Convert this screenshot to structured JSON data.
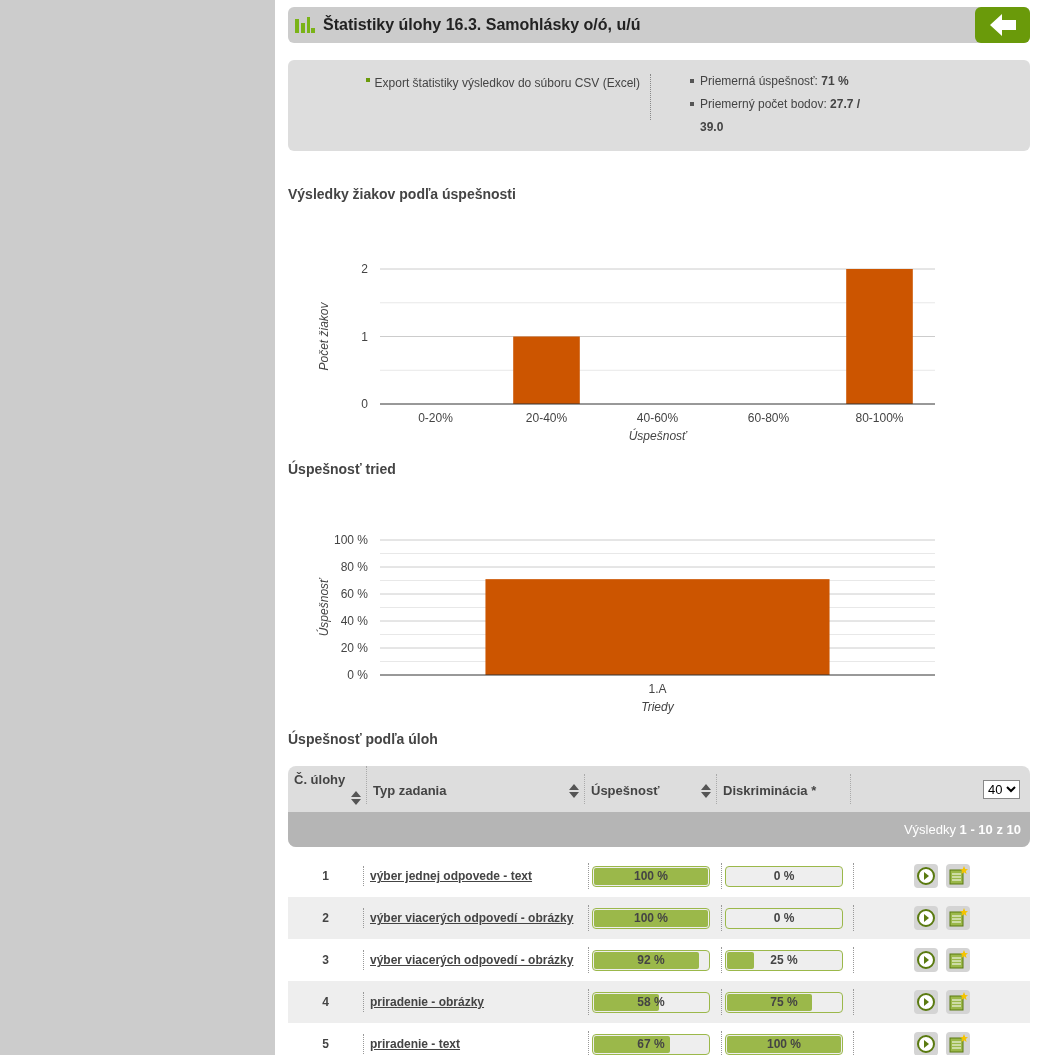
{
  "header": {
    "title": "Štatistiky úlohy 16.3. Samohlásky o/ó, u/ú"
  },
  "summary": {
    "export_link": "Export štatistiky výsledkov do súboru CSV (Excel)",
    "stats": [
      "Priemerná úspešnosť: **71 %**",
      "Priemerný počet bodov: **27.7 / 39.0**"
    ]
  },
  "sections": [
    {
      "title": "Výsledky žiakov podľa úspešnosti",
      "chart_data": {
        "type": "bar",
        "xlabel": "Úspešnosť",
        "ylabel": "Počet žiakov",
        "categories": [
          "0-20%",
          "20-40%",
          "40-60%",
          "60-80%",
          "80-100%"
        ],
        "series": [
          {
            "color": "#cc5500",
            "values": [
              0,
              1,
              0,
              0,
              2
            ]
          }
        ],
        "grid": true,
        "ref_lines": [
          {
            "axis": "y",
            "value": 0.5
          },
          {
            "axis": "y",
            "value": 1.5
          }
        ],
        "ylim": [
          0,
          2
        ],
        "yticks": [
          0,
          1,
          2
        ]
      }
    },
    {
      "title": "Úspešnosť tried",
      "chart_data": {
        "type": "bar",
        "xlabel": "Triedy",
        "ylabel": "Úspešnosť",
        "categories": [
          "1.A"
        ],
        "series": [
          {
            "color": "#cc5500",
            "values": [
              71
            ]
          }
        ],
        "grid": true,
        "ref_lines": [
          {
            "axis": "y",
            "value": 10
          },
          {
            "axis": "y",
            "value": 30
          },
          {
            "axis": "y",
            "value": 50
          },
          {
            "axis": "y",
            "value": 70
          },
          {
            "axis": "y",
            "value": 90
          }
        ],
        "ylim": [
          0,
          100
        ],
        "yticks": [
          {
            "value": 0,
            "label": "0 %"
          },
          {
            "value": 20,
            "label": "20 %"
          },
          {
            "value": 40,
            "label": "40 %"
          },
          {
            "value": 60,
            "label": "60 %"
          },
          {
            "value": 80,
            "label": "80 %"
          },
          {
            "value": 100,
            "label": "100 %"
          }
        ]
      }
    }
  ],
  "table_section": {
    "title": "Úspešnosť podľa úloh",
    "columns": [
      {
        "label": "Č. úlohy",
        "sortable": true
      },
      {
        "label": "Typ zadania",
        "sortable": true
      },
      {
        "label": "Úspešnosť",
        "sortable": true
      },
      {
        "label": "Diskriminácia *",
        "sortable": false
      }
    ],
    "page_size": "40",
    "results": "Výsledky **1 - 10 z 10**",
    "rows": [
      {
        "number": "1",
        "type": "výber jednej odpovede - text",
        "success": {
          "text": "100 %",
          "level": 1
        },
        "discrimination": {
          "text": "0 %",
          "level": 0
        }
      },
      {
        "number": "2",
        "type": "výber viacerých odpovedí - obrázky",
        "success": {
          "text": "100 %",
          "level": 1
        },
        "discrimination": {
          "text": "0 %",
          "level": 0
        }
      },
      {
        "number": "3",
        "type": "výber viacerých odpovedí - obrázky",
        "success": {
          "text": "92 %",
          "level": 0.92
        },
        "discrimination": {
          "text": "25 %",
          "level": 0.25
        }
      },
      {
        "number": "4",
        "type": "priradenie - obrázky",
        "success": {
          "text": "58 %",
          "level": 0.58
        },
        "discrimination": {
          "text": "75 %",
          "level": 0.75
        }
      },
      {
        "number": "5",
        "type": "priradenie - text",
        "success": {
          "text": "67 %",
          "level": 0.67
        },
        "discrimination": {
          "text": "100 %",
          "level": 1
        }
      }
    ]
  }
}
